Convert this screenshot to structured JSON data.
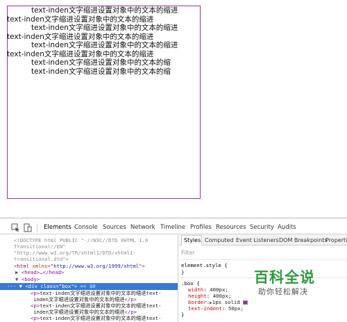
{
  "demo": {
    "lines": [
      {
        "text": "text-inden文字缩进设置对象中的文本的缩进",
        "indent": true
      },
      {
        "text": "text-inden文字缩进设置对象中的文本的缩进",
        "indent": false
      },
      {
        "text": "text-inden文字缩进设置对象中的文本的缩进",
        "indent": true
      },
      {
        "text": "text-inden文字缩进设置对象中的文本的缩进",
        "indent": false
      },
      {
        "text": "text-inden文字缩进设置对象中的文本的缩进",
        "indent": true
      },
      {
        "text": "text-inden文字缩进设置对象中的文本的缩进",
        "indent": false
      },
      {
        "text": "text-inden文字缩进设置对象中的文本的缩",
        "indent": true
      },
      {
        "text": "text-inden文字缩进设置对象中的文本的缩",
        "indent": true
      }
    ]
  },
  "devtools": {
    "tabs": [
      "Elements",
      "Console",
      "Sources",
      "Network",
      "Timeline",
      "Profiles",
      "Resources",
      "Security",
      "Audits"
    ],
    "active_tab": "Elements",
    "dom": {
      "doctype_1": "<!DOCTYPE html PUBLIC \"-//W3C//DTD XHTML 1.0",
      "doctype_2": "Transitional//EN\"",
      "doctype_3": "\"http://www.w3.org/TR/xhtml1/DTD/xhtml1-",
      "doctype_4": "transitional.dtd\">",
      "html_open": "<html ",
      "html_attr": "xmlns",
      "html_eq": "=\"",
      "html_val": "http://www.w3.org/1999/xhtml",
      "html_close": "\">",
      "head_open": "<head>",
      "head_ellipsis": "…",
      "head_close": "</head>",
      "body_open": "<body>",
      "div_open": "<div ",
      "div_attr": "class",
      "div_eq": "=\"",
      "div_val": "box",
      "div_close": "\">",
      "div_marker": "== $0",
      "p1_a": "text-inden文字缩进设置对象中的文本的缩进text-",
      "p1_b": "inden文字缩进设置对象中的文本的缩进",
      "p2_a": "text-inden文字缩进设置对象中的文本的缩进text-",
      "p2_b": "inden文字缩进设置对象中的文本的缩进",
      "p3_a": "text-inden文字缩进设置对象中的文本的缩进text-",
      "p_open": "<p>",
      "p_close": "</p>"
    },
    "styles": {
      "tabs": [
        "Styles",
        "Computed",
        "Event Listeners",
        "DOM Breakpoints",
        "Properties"
      ],
      "active_tab": "Styles",
      "filter_placeholder": "Filter",
      "element_style": "element.style {",
      "close_brace": "}",
      "box_selector": ".box {",
      "props": [
        {
          "name": "width",
          "value": "400px;"
        },
        {
          "name": "height",
          "value": "400px;"
        },
        {
          "name": "border",
          "value": "1px solid"
        },
        {
          "name": "text-indent",
          "value": "50px;"
        }
      ],
      "swatch_color": "#a02ca0"
    }
  },
  "watermark": {
    "title": "百科全说",
    "subtitle": "助你轻松解决"
  }
}
